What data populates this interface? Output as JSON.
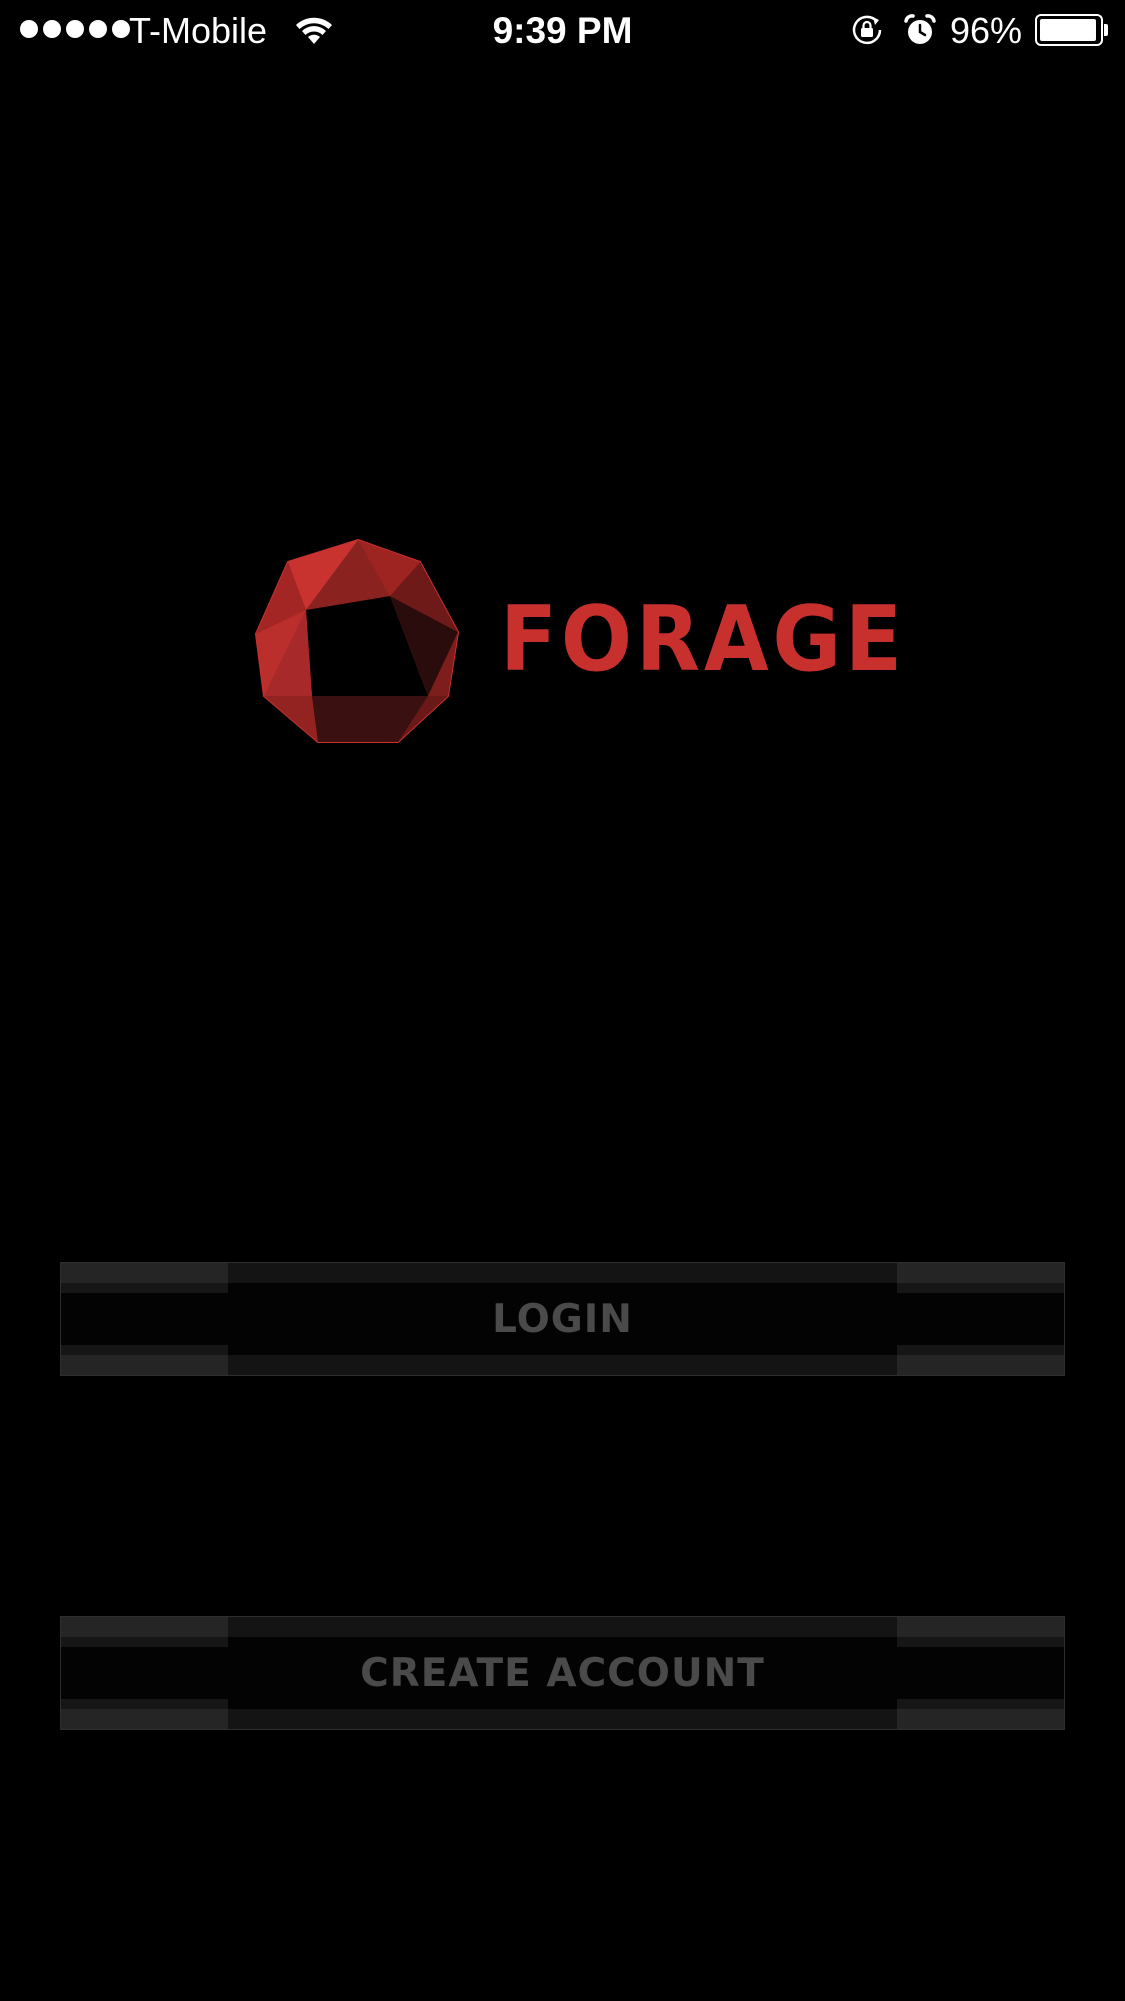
{
  "status_bar": {
    "signal_bars": 5,
    "carrier": "T-Mobile",
    "wifi_icon": "wifi-icon",
    "time": "9:39 PM",
    "rotation_lock_icon": "rotation-lock-icon",
    "alarm_icon": "alarm-icon",
    "battery_percent": "96%",
    "battery_level": 0.96
  },
  "logo": {
    "wordmark": "FORAGE",
    "mark_icon": "forage-polygon-logo",
    "brand_color": "#c8302e"
  },
  "actions": {
    "login_label": "LOGIN",
    "create_account_label": "CREATE ACCOUNT",
    "label_color": "#4a4a4a"
  }
}
